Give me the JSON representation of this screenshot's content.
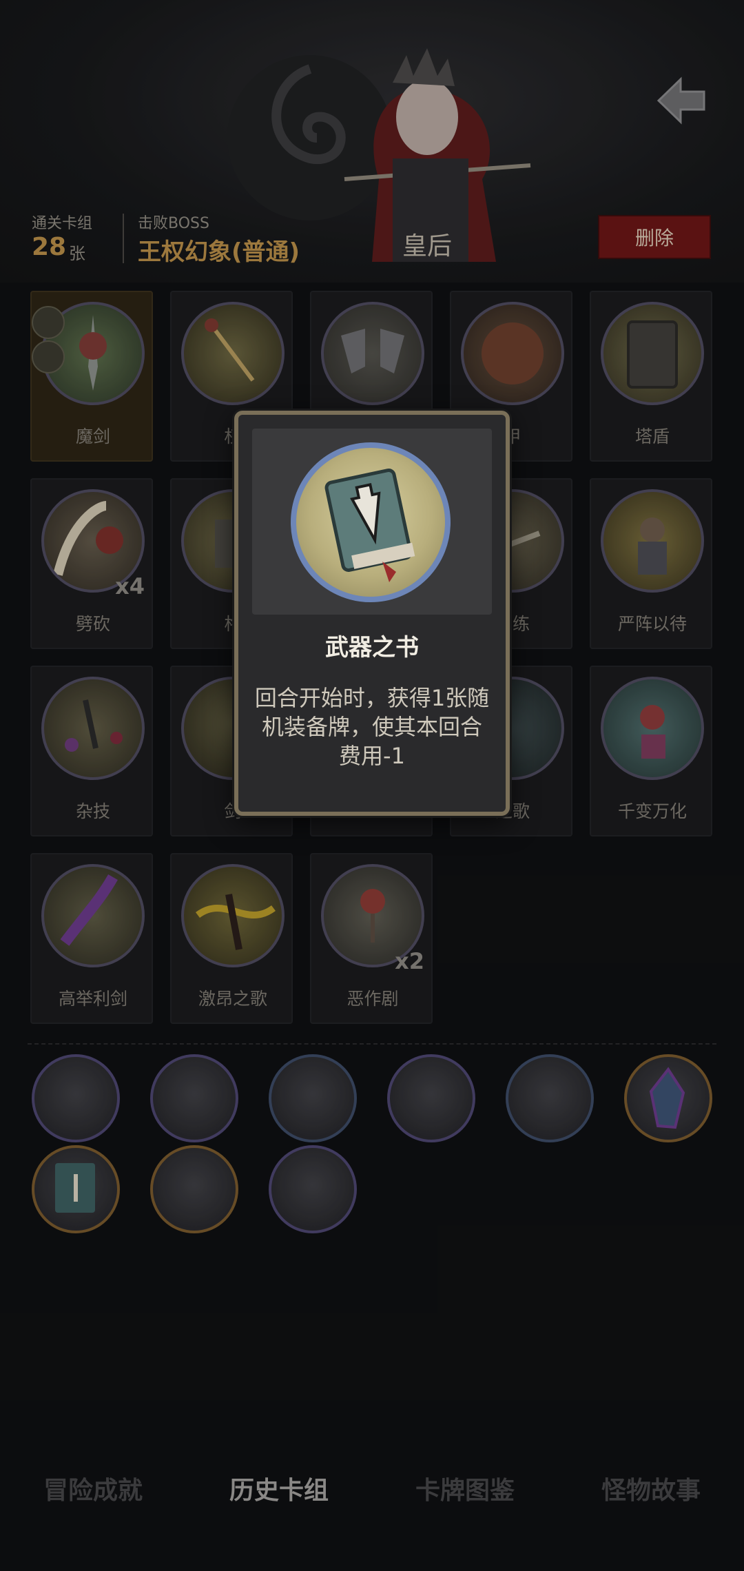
{
  "header": {
    "cleared_deck_label": "通关卡组",
    "cleared_deck_count": "28",
    "cleared_deck_unit": "张",
    "defeated_boss_label": "击败BOSS",
    "boss_name": "王权幻象(普通)",
    "character_name": "皇后",
    "delete_label": "删除"
  },
  "cards": [
    {
      "name": "魔剑",
      "count": "",
      "selected": true
    },
    {
      "name": "权",
      "count": ""
    },
    {
      "name": "",
      "count": ""
    },
    {
      "name": "甲",
      "count": ""
    },
    {
      "name": "塔盾",
      "count": ""
    },
    {
      "name": "劈砍",
      "count": "x4"
    },
    {
      "name": "格",
      "count": ""
    },
    {
      "name": "",
      "count": ""
    },
    {
      "name": "训练",
      "count": ""
    },
    {
      "name": "严阵以待",
      "count": ""
    },
    {
      "name": "杂技",
      "count": ""
    },
    {
      "name": "剑",
      "count": ""
    },
    {
      "name": "",
      "count": ""
    },
    {
      "name": "之歌",
      "count": ""
    },
    {
      "name": "千变万化",
      "count": ""
    },
    {
      "name": "高举利剑",
      "count": ""
    },
    {
      "name": "激昂之歌",
      "count": ""
    },
    {
      "name": "恶作剧",
      "count": "x2"
    }
  ],
  "popup": {
    "title": "武器之书",
    "description": "回合开始时，获得1张随机装备牌，使其本回合费用-1"
  },
  "tabs": [
    "冒险成就",
    "历史卡组",
    "卡牌图鉴",
    "怪物故事"
  ],
  "active_tab": "历史卡组"
}
